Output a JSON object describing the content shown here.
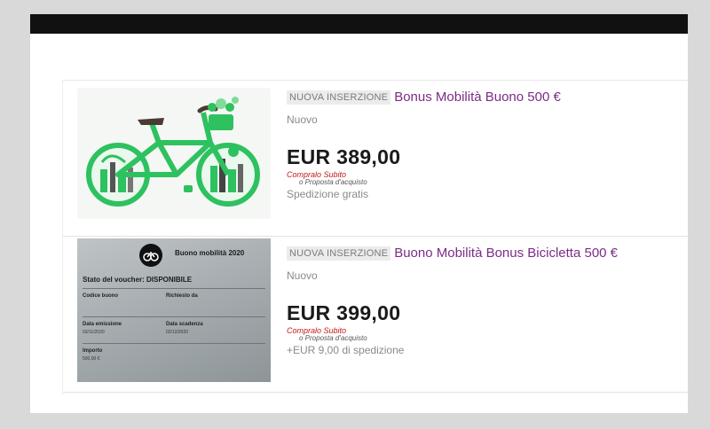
{
  "listings": [
    {
      "badge": "NUOVA INSERZIONE",
      "title": "Bonus Mobilità Buono 500 €",
      "condition": "Nuovo",
      "price": "EUR 389,00",
      "buy_now": "Compralo Subito",
      "best_offer": "o Proposta d'acquisto",
      "shipping": "Spedizione gratis",
      "image_icon": "green-bicycle-illustration"
    },
    {
      "badge": "NUOVA INSERZIONE",
      "title": "Buono Mobilità Bonus Bicicletta 500 €",
      "condition": "Nuovo",
      "price": "EUR 399,00",
      "buy_now": "Compralo Subito",
      "best_offer": "o Proposta d'acquisto",
      "shipping": "+EUR 9,00 di spedizione",
      "image_icon": "voucher-photo",
      "voucher": {
        "brand": "Buono mobilità 2020",
        "status": "Stato del voucher: DISPONIBILE",
        "code_label": "Codice buono",
        "requested_label": "Richiesto da",
        "issue_label": "Data emissione",
        "issue_date": "03/11/2020",
        "expiry_label": "Data scadenza",
        "expiry_date": "02/12/2020",
        "amount_label": "Importo",
        "amount": "500,00 €"
      }
    }
  ],
  "colors": {
    "title": "#7b2c86",
    "price": "#1a1a1a",
    "bike_green": "#2ec15f",
    "buy_now_red": "#c21b17"
  }
}
